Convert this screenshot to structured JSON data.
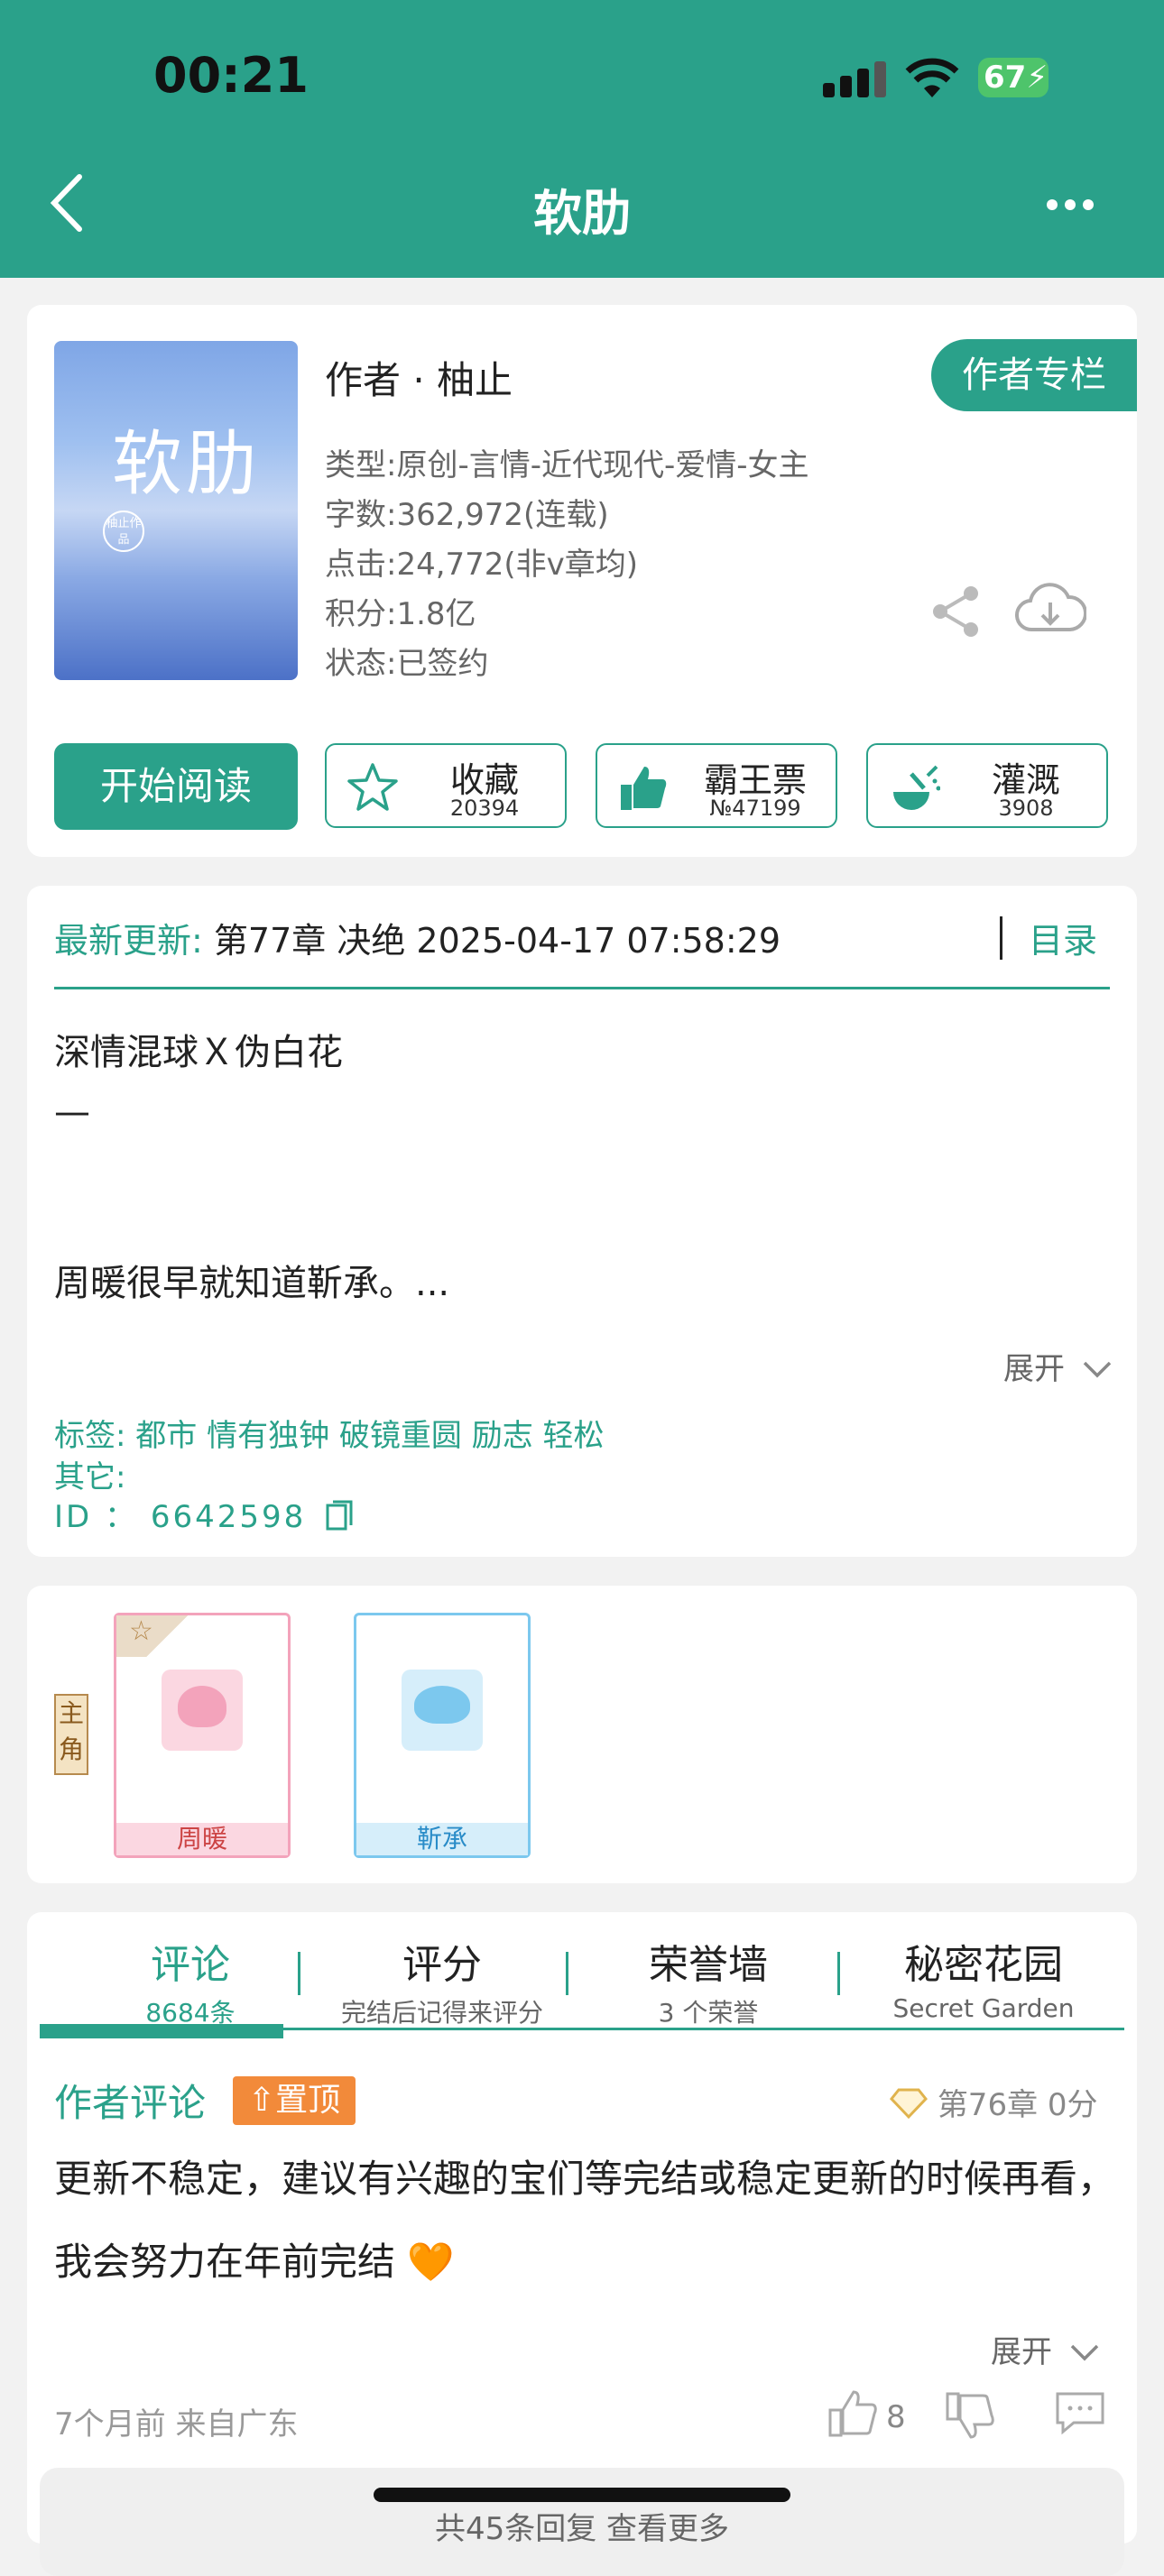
{
  "status_bar": {
    "time": "00:21",
    "battery": "67"
  },
  "nav": {
    "title": "软肋"
  },
  "book": {
    "cover_title": "软肋",
    "cover_seal": "柚止作品",
    "author": "作者 · 柚止",
    "author_button": "作者专栏",
    "type": "类型:原创-言情-近代现代-爱情-女主",
    "words": "字数:362,972(连载)",
    "clicks": "点击:24,772(非v章均)",
    "points": "积分:1.8亿",
    "status": "状态:已签约",
    "read_button": "开始阅读",
    "actions": [
      {
        "label": "收藏",
        "count": "20394",
        "icon": "star-icon"
      },
      {
        "label": "霸王票",
        "count": "№47199",
        "icon": "thumbs-up-icon"
      },
      {
        "label": "灌溉",
        "count": "3908",
        "icon": "watering-icon"
      }
    ]
  },
  "update": {
    "label": "最新更新:",
    "chapter": "第77章 决绝 2025-04-17 07:58:29",
    "toc": "目录",
    "summary": [
      "深情混球Ｘ伪白花",
      "—",
      "周暖很早就知道靳承。..."
    ],
    "expand": "展开",
    "tags_label": "标签:",
    "tags": "都市  情有独钟  破镜重圆  励志  轻松",
    "other": "其它:",
    "id": "ID  ：  6642598"
  },
  "characters": {
    "badge": [
      "主",
      "角"
    ],
    "list": [
      {
        "name": "周暖",
        "color": "#f3a3bb"
      },
      {
        "name": "靳承",
        "color": "#7cc8ee"
      }
    ]
  },
  "comments": {
    "tabs": [
      {
        "title": "评论",
        "sub": "8684条"
      },
      {
        "title": "评分",
        "sub": "完结后记得来评分"
      },
      {
        "title": "荣誉墙",
        "sub": "3 个荣誉"
      },
      {
        "title": "秘密花园",
        "sub": "Secret Garden"
      }
    ],
    "author_comment_label": "作者评论",
    "pin_label": "置顶",
    "chapter_info": "第76章  0分",
    "text": "更新不稳定，建议有兴趣的宝们等完结或稳定更新的时候再看，我会努力在年前完结 🧡",
    "expand": "展开",
    "meta": "7个月前  来自广东",
    "likes": "8",
    "replies": "共45条回复 查看更多"
  },
  "colors": {
    "accent": "#2aa18a",
    "pin": "#f28a3a"
  }
}
